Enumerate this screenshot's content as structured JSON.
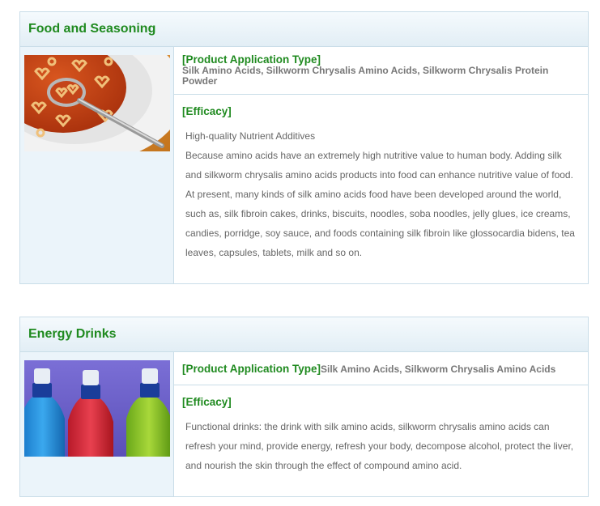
{
  "sections": [
    {
      "title": "Food and Seasoning",
      "type_label": "[Product Application Type]",
      "type_value": "Silk Amino Acids, Silkworm Chrysalis Amino Acids, Silkworm Chrysalis Protein Powder",
      "efficacy_label": "[Efficacy]",
      "efficacy_paragraphs": [
        "High-quality Nutrient Additives",
        "Because amino acids have an extremely high nutritive value to human body. Adding silk and silkworm chrysalis amino acids products into food can enhance nutritive value of food. At present, many kinds of silk amino acids food have been developed around the world, such as, silk fibroin cakes, drinks, biscuits, noodles, soba noodles, jelly glues, ice creams, candies, porridge, soy sauce, and foods containing silk fibroin like glossocardia bidens, tea leaves, capsules, tablets, milk and so on."
      ]
    },
    {
      "title": "Energy Drinks",
      "type_label": "[Product Application Type]",
      "type_value": "Silk Amino Acids, Silkworm Chrysalis Amino Acids",
      "efficacy_label": "[Efficacy]",
      "efficacy_paragraphs": [
        "Functional drinks: the drink with silk amino acids, silkworm chrysalis amino acids can refresh your mind, provide energy, refresh your body, decompose alcohol, protect the liver, and nourish the skin through the effect of compound amino acid."
      ]
    }
  ],
  "colors": {
    "heading_green": "#1f8a1f",
    "border": "#c9dde8",
    "sidebar_bg": "#ebf4fa"
  }
}
